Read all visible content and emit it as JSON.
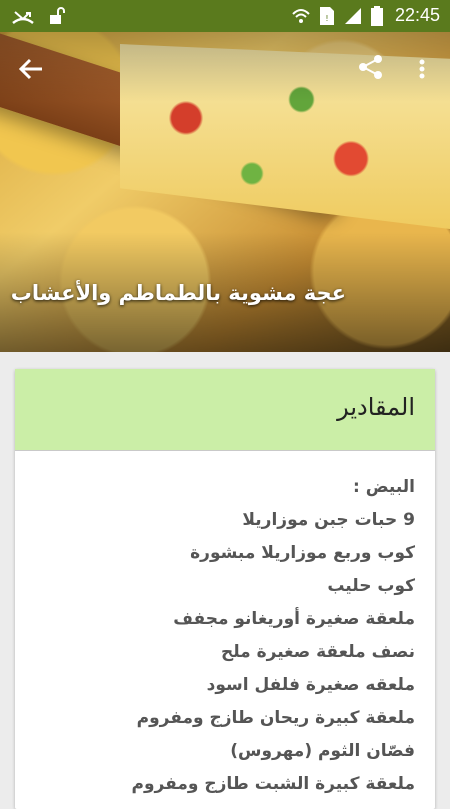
{
  "status_bar": {
    "time": "22:45"
  },
  "hero": {
    "title": "عجة مشوية بالطماطم والأعشاب"
  },
  "ingredients_card": {
    "header": "المقادير",
    "items": [
      "البيض :",
      "9 حبات جبن موزاريلا",
      "كوب وربع موزاريلا مبشورة",
      "كوب حليب",
      "ملعقة صغيرة أوريغانو مجفف",
      "نصف ملعقة صغيرة ملح",
      "ملعقه صغيرة فلفل اسود",
      "ملعقة كبيرة ريحان طازج ومفروم",
      "فصّان الثوم (مهروس)",
      "ملعقة كبيرة الشبت طازج ومفروم"
    ]
  },
  "colors": {
    "status_bar": "#5a7a1d",
    "card_header": "#cbeea7",
    "page_background": "#ececec"
  },
  "icons": [
    "missed-call-icon",
    "unlock-icon",
    "wifi-icon",
    "sim-card-icon",
    "signal-icon",
    "battery-icon",
    "back-arrow-icon",
    "share-icon",
    "more-vert-icon"
  ]
}
